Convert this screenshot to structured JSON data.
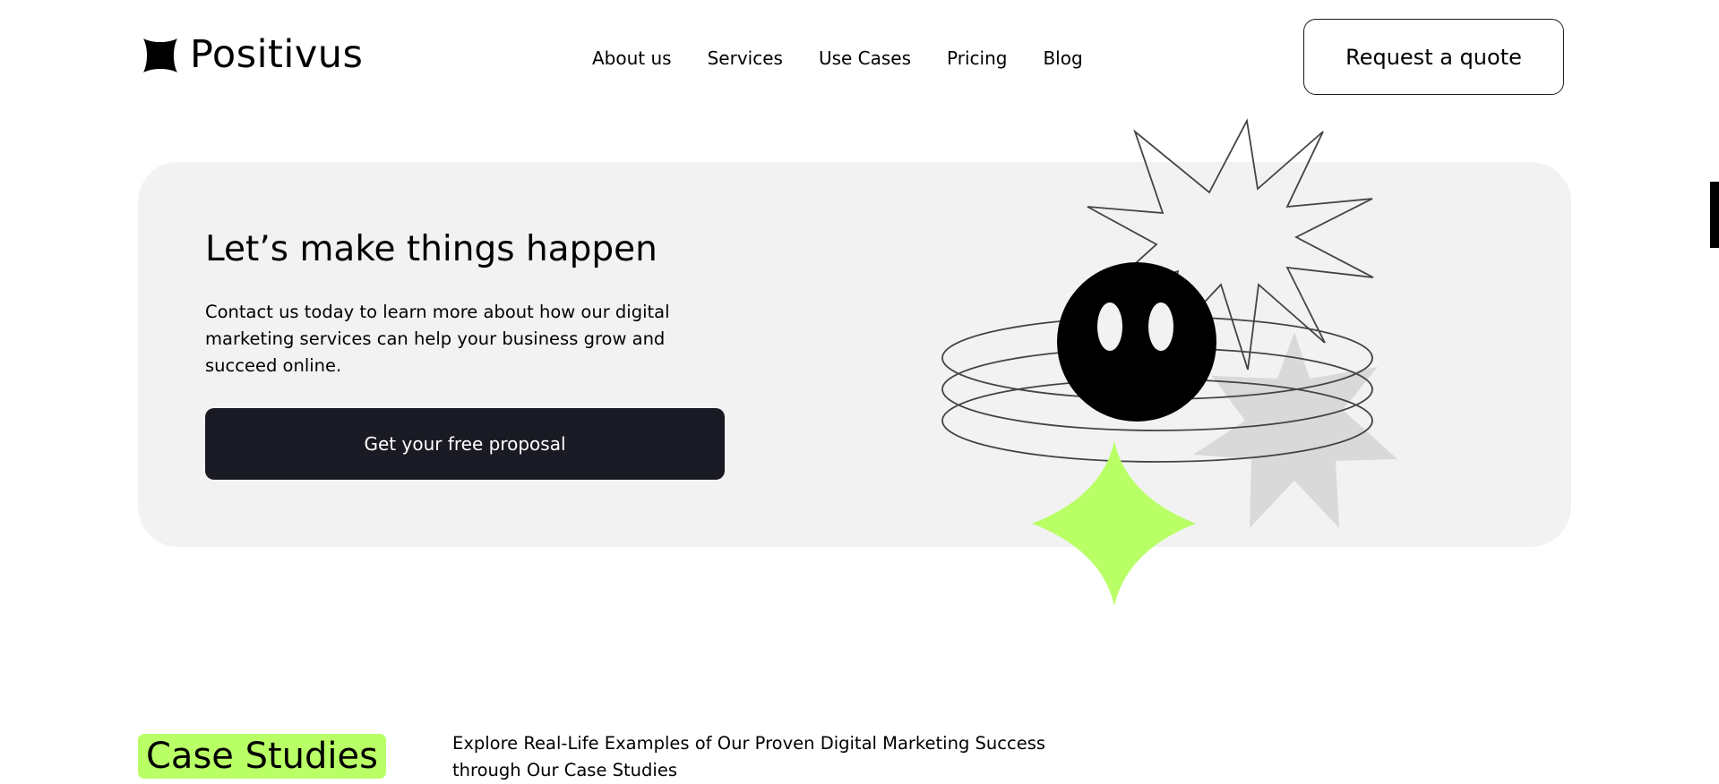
{
  "header": {
    "brand": "Positivus",
    "nav": [
      "About us",
      "Services",
      "Use Cases",
      "Pricing",
      "Blog"
    ],
    "cta_label": "Request a quote"
  },
  "cta": {
    "title": "Let’s make things happen",
    "text": "Contact us today to learn more about how our digital marketing services can help your business grow and succeed online.",
    "button_label": "Get your free proposal"
  },
  "case_studies": {
    "heading": "Case Studies",
    "description": "Explore Real-Life Examples of Our Proven Digital Marketing Success through Our Case Studies"
  },
  "colors": {
    "accent": "#b9ff66",
    "dark": "#191a23",
    "card_bg": "#f2f2f2"
  }
}
